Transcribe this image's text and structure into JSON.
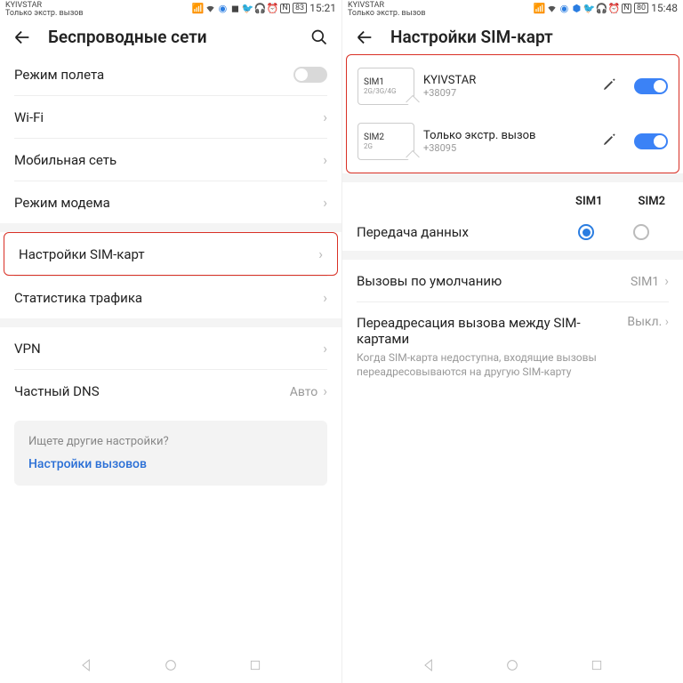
{
  "left": {
    "status": {
      "carrier": "KYIVSTAR",
      "sub": "Только экстр. вызов",
      "battery": "83",
      "time": "15:21"
    },
    "title": "Беспроводные сети",
    "rows": {
      "airplane": "Режим полета",
      "wifi": "Wi-Fi",
      "mobile": "Мобильная сеть",
      "modem": "Режим модема",
      "sim": "Настройки SIM-карт",
      "traffic": "Статистика трафика",
      "vpn": "VPN",
      "dns": "Частный DNS",
      "dns_val": "Авто"
    },
    "suggest": {
      "q": "Ищете другие настройки?",
      "link": "Настройки вызовов"
    }
  },
  "right": {
    "status": {
      "carrier": "KYIVSTAR",
      "sub": "Только экстр. вызов",
      "battery": "80",
      "time": "15:48"
    },
    "title": "Настройки SIM-карт",
    "sim1": {
      "slot": "SIM1",
      "net": "2G/3G/4G",
      "carrier": "KYIVSTAR",
      "number": "+38097"
    },
    "sim2": {
      "slot": "SIM2",
      "net": "2G",
      "carrier": "Только экстр. вызов",
      "number": "+38095"
    },
    "cols": {
      "c1": "SIM1",
      "c2": "SIM2"
    },
    "data_label": "Передача данных",
    "calls": {
      "label": "Вызовы по умолчанию",
      "val": "SIM1"
    },
    "fwd": {
      "title": "Переадресация вызова между SIM-картами",
      "desc": "Когда SIM-карта недоступна, входящие вызовы переадресовываются на другую SIM-карту",
      "val": "Выкл."
    }
  }
}
